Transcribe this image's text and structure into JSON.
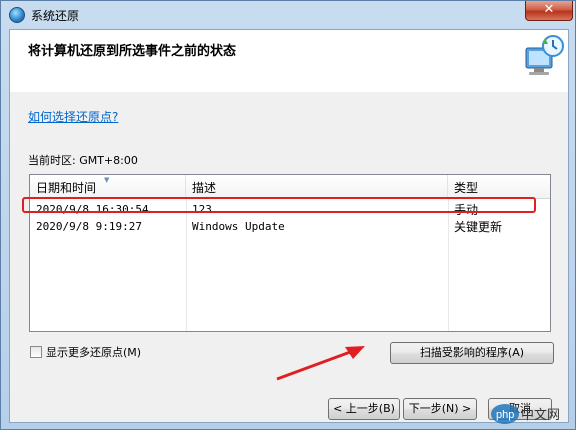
{
  "window": {
    "title": "系统还原",
    "close_label": "✕"
  },
  "header": {
    "title": "将计算机还原到所选事件之前的状态"
  },
  "help_link": "如何选择还原点?",
  "timezone_label": "当前时区: GMT+8:00",
  "list": {
    "columns": [
      "日期和时间",
      "描述",
      "类型"
    ],
    "rows": [
      {
        "date": "2020/9/8 16:30:54",
        "desc": "123",
        "type": "手动"
      },
      {
        "date": "2020/9/8 9:19:27",
        "desc": "Windows Update",
        "type": "关键更新"
      }
    ]
  },
  "show_more_label": "显示更多还原点(M)",
  "buttons": {
    "scan": "扫描受影响的程序(A)",
    "back": "< 上一步(B)",
    "next": "下一步(N) >",
    "cancel": "取消"
  },
  "watermark": {
    "text": "php 中文网"
  },
  "colors": {
    "highlight": "#e02020",
    "arrow": "#e02020",
    "link": "#0066cc"
  }
}
